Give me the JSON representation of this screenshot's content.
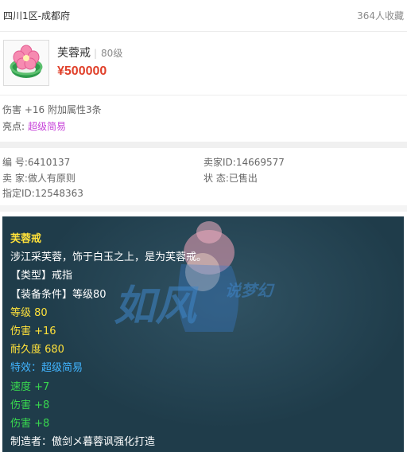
{
  "header": {
    "server": "四川1区-成都府",
    "favorites": "364人收藏"
  },
  "item": {
    "name": "芙蓉戒",
    "level": "80级",
    "price": "¥500000",
    "icon": "jade-ring-with-flower-icon"
  },
  "attributes": {
    "summary": "伤害 +16 附加属性3条",
    "highlight_label": "亮点:",
    "highlight_value": "超级简易"
  },
  "info": {
    "serial": "编 号:6410137",
    "seller_id": "卖家ID:14669577",
    "seller": "卖 家:做人有原则",
    "status": "状 态:已售出",
    "assigned_id": "指定ID:12548363"
  },
  "tooltip": {
    "lines": [
      "芙蓉戒",
      "涉江采芙蓉，饰于白玉之上，是为芙蓉戒。",
      "【类型】戒指",
      "【装备条件】等级80",
      "等级 80",
      "伤害 +16",
      "耐久度 680",
      "特效：超级简易",
      "速度 +7",
      "伤害 +8",
      "伤害 +8",
      "制造者：傲剑メ暮蓉讽强化打造"
    ],
    "watermark": "如风 说梦幻"
  },
  "colors": {
    "price": "#e0402a",
    "highlight": "#c63fd9",
    "tooltip_bg": "#1f3c4a",
    "tooltip_title": "#ffe13a",
    "tooltip_effect": "#41b4ff",
    "tooltip_bonus": "#39d94f"
  }
}
